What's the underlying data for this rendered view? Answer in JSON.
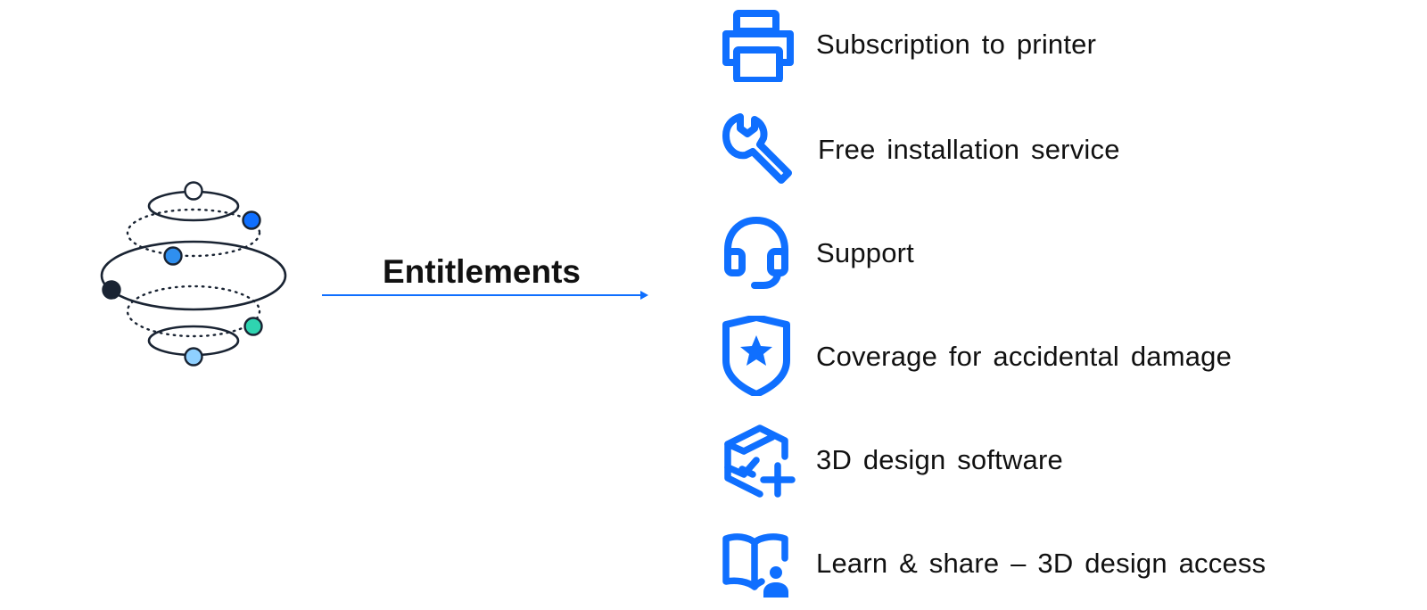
{
  "diagram": {
    "arrow_label": "Entitlements",
    "accent_color": "#0f6fff",
    "items": [
      {
        "label": "Subscription to printer",
        "icon": "printer-icon"
      },
      {
        "label": "Free installation service",
        "icon": "wrench-icon"
      },
      {
        "label": "Support",
        "icon": "headset-icon"
      },
      {
        "label": "Coverage for accidental damage",
        "icon": "shield-star-icon"
      },
      {
        "label": "3D design software",
        "icon": "3d-design-software-icon"
      },
      {
        "label": "Learn & share – 3D design access",
        "icon": "book-user-icon"
      }
    ],
    "orbit_graphic": {
      "icon": "orbit-ecosystem-icon",
      "node_colors": [
        "#ffffff",
        "#0f6fff",
        "#2f8fef",
        "#1a2433",
        "#2fd4b0",
        "#8fd0ff"
      ]
    }
  }
}
